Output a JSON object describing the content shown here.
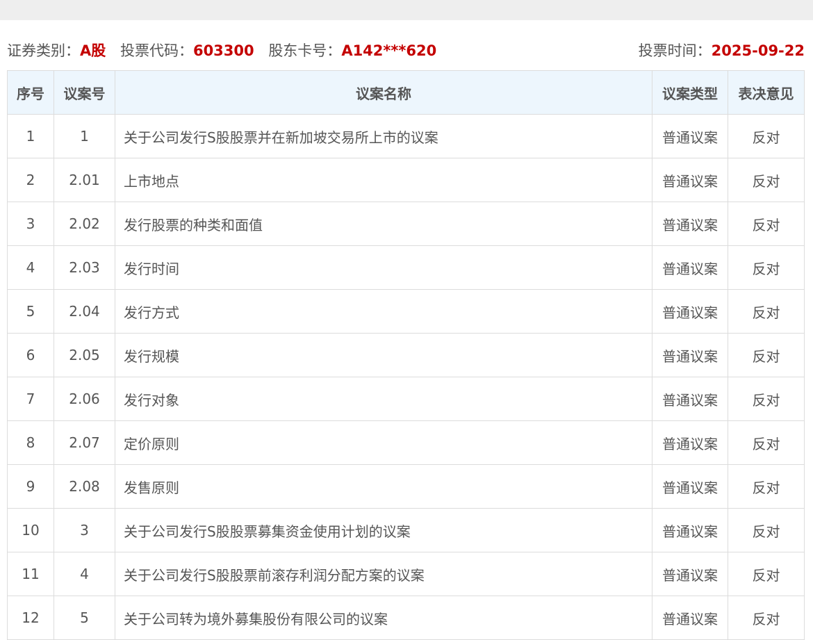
{
  "info": {
    "category_label": "证券类别：",
    "category_value": "A股",
    "code_label": "投票代码：",
    "code_value": "603300",
    "card_label": "股东卡号：",
    "card_value": "A142***620",
    "date_label": "投票时间：",
    "date_value": "2025-09-22"
  },
  "table": {
    "headers": [
      "序号",
      "议案号",
      "议案名称",
      "议案类型",
      "表决意见"
    ],
    "rows": [
      {
        "seq": "1",
        "no": "1",
        "name": "关于公司发行S股股票并在新加坡交易所上市的议案",
        "type": "普通议案",
        "vote": "反对"
      },
      {
        "seq": "2",
        "no": "2.01",
        "name": "上市地点",
        "type": "普通议案",
        "vote": "反对"
      },
      {
        "seq": "3",
        "no": "2.02",
        "name": "发行股票的种类和面值",
        "type": "普通议案",
        "vote": "反对"
      },
      {
        "seq": "4",
        "no": "2.03",
        "name": "发行时间",
        "type": "普通议案",
        "vote": "反对"
      },
      {
        "seq": "5",
        "no": "2.04",
        "name": "发行方式",
        "type": "普通议案",
        "vote": "反对"
      },
      {
        "seq": "6",
        "no": "2.05",
        "name": "发行规模",
        "type": "普通议案",
        "vote": "反对"
      },
      {
        "seq": "7",
        "no": "2.06",
        "name": "发行对象",
        "type": "普通议案",
        "vote": "反对"
      },
      {
        "seq": "8",
        "no": "2.07",
        "name": "定价原则",
        "type": "普通议案",
        "vote": "反对"
      },
      {
        "seq": "9",
        "no": "2.08",
        "name": "发售原则",
        "type": "普通议案",
        "vote": "反对"
      },
      {
        "seq": "10",
        "no": "3",
        "name": "关于公司发行S股股票募集资金使用计划的议案",
        "type": "普通议案",
        "vote": "反对"
      },
      {
        "seq": "11",
        "no": "4",
        "name": "关于公司发行S股股票前滚存利润分配方案的议案",
        "type": "普通议案",
        "vote": "反对"
      },
      {
        "seq": "12",
        "no": "5",
        "name": "关于公司转为境外募集股份有限公司的议案",
        "type": "普通议案",
        "vote": "反对"
      }
    ]
  }
}
